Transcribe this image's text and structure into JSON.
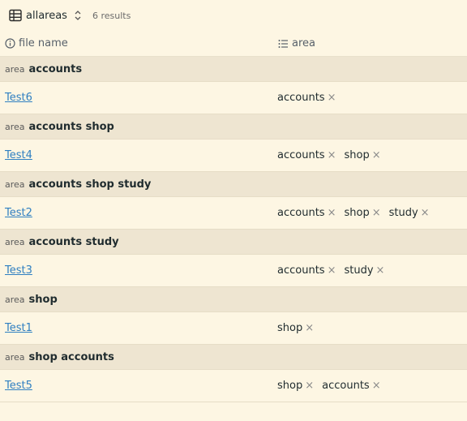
{
  "toolbar": {
    "view_name": "allareas",
    "results": "6 results"
  },
  "columns": {
    "file_name": "file name",
    "area": "area"
  },
  "group_label": "area",
  "groups": [
    {
      "value": "accounts",
      "rows": [
        {
          "name": "Test6",
          "tags": [
            "accounts"
          ]
        }
      ]
    },
    {
      "value": "accounts shop",
      "rows": [
        {
          "name": "Test4",
          "tags": [
            "accounts",
            "shop"
          ]
        }
      ]
    },
    {
      "value": "accounts shop study",
      "rows": [
        {
          "name": "Test2",
          "tags": [
            "accounts",
            "shop",
            "study"
          ]
        }
      ]
    },
    {
      "value": "accounts study",
      "rows": [
        {
          "name": "Test3",
          "tags": [
            "accounts",
            "study"
          ]
        }
      ]
    },
    {
      "value": "shop",
      "rows": [
        {
          "name": "Test1",
          "tags": [
            "shop"
          ]
        }
      ]
    },
    {
      "value": "shop accounts",
      "rows": [
        {
          "name": "Test5",
          "tags": [
            "shop",
            "accounts"
          ]
        }
      ]
    }
  ],
  "remove_glyph": "×",
  "icons": {
    "view": "table-icon",
    "sort": "chevron-updown-icon",
    "file_col": "info-icon",
    "area_col": "list-icon"
  }
}
